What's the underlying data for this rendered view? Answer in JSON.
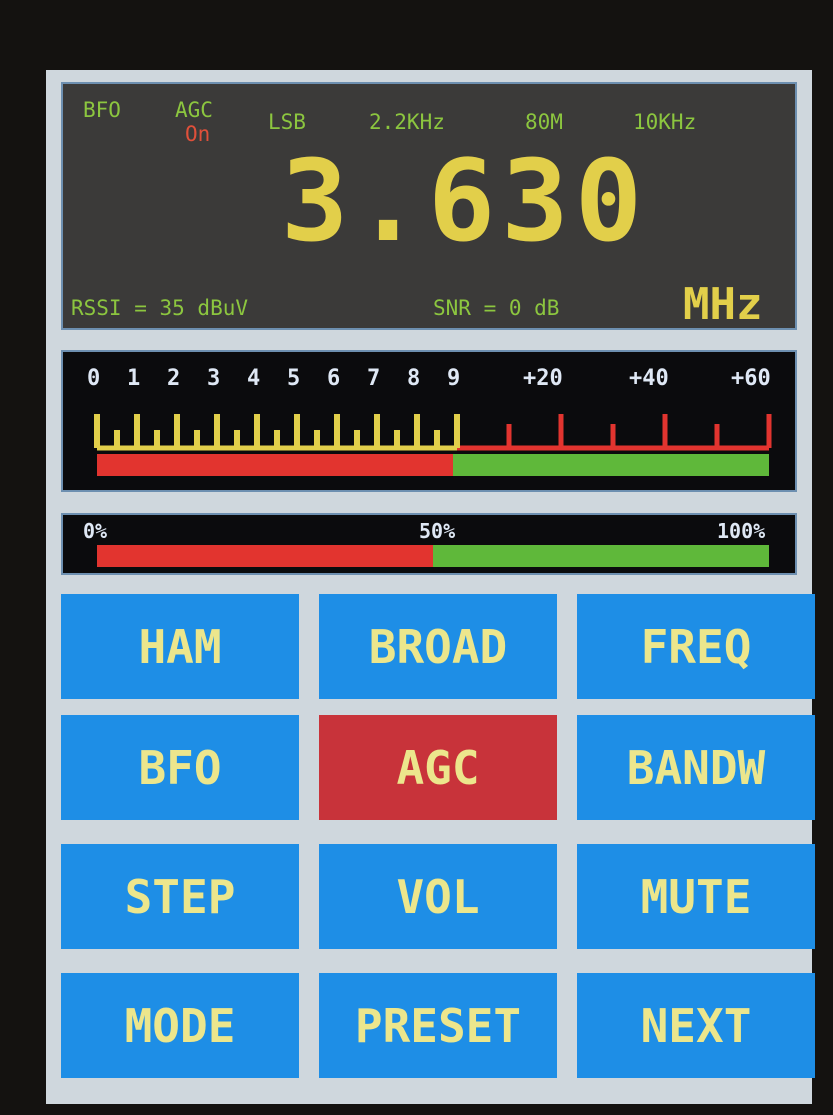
{
  "status": {
    "bfo": "BFO",
    "agc": "AGC",
    "agc_state": "On",
    "mode": "LSB",
    "bandwidth": "2.2KHz",
    "band": "80M",
    "step": "10KHz"
  },
  "frequency": {
    "value": "3.630",
    "unit": "MHz"
  },
  "signal": {
    "rssi": "RSSI = 35 dBuV",
    "snr": "SNR = 0 dB"
  },
  "smeter": {
    "labels": [
      "0",
      "1",
      "2",
      "3",
      "4",
      "5",
      "6",
      "7",
      "8",
      "9",
      "+20",
      "+40",
      "+60"
    ],
    "level_fraction": 0.53,
    "colors": {
      "low": "#e2342f",
      "high": "#5fb83a",
      "scale_low": "#e2cf4a",
      "scale_high": "#e2342f"
    }
  },
  "volume_meter": {
    "labels": [
      "0%",
      "50%",
      "100%"
    ],
    "level_fraction": 0.5
  },
  "buttons": [
    {
      "label": "HAM",
      "active": false
    },
    {
      "label": "BROAD",
      "active": false
    },
    {
      "label": "FREQ",
      "active": false
    },
    {
      "label": "BFO",
      "active": false
    },
    {
      "label": "AGC",
      "active": true
    },
    {
      "label": "BANDW",
      "active": false
    },
    {
      "label": "STEP",
      "active": false
    },
    {
      "label": "VOL",
      "active": false
    },
    {
      "label": "MUTE",
      "active": false
    },
    {
      "label": "MODE",
      "active": false
    },
    {
      "label": "PRESET",
      "active": false
    },
    {
      "label": "NEXT",
      "active": false
    }
  ]
}
